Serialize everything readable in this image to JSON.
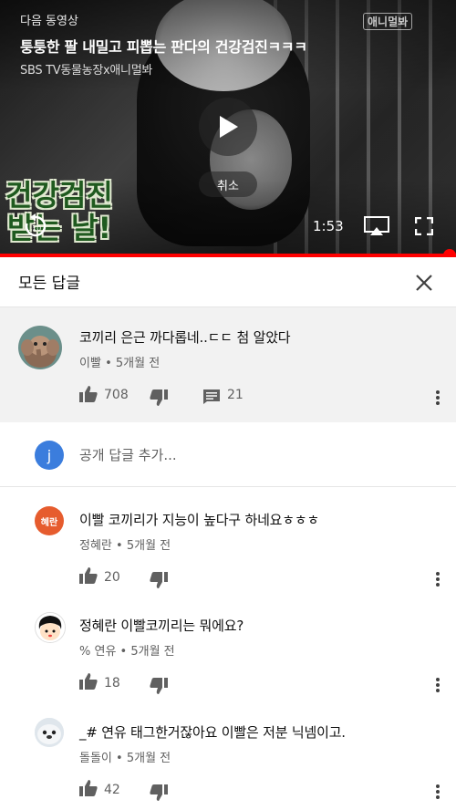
{
  "player": {
    "next_label": "다음 동영상",
    "title": "퉁퉁한 팔 내밀고 피뽑는 판다의 건강검진ㅋㅋㅋ",
    "channel": "SBS TV동물농장x애니멀봐",
    "watermark": "애니멀봐",
    "caption_line1": "건강검진",
    "caption_line2": "받는 날!",
    "cancel_label": "취소",
    "time": "1:53",
    "progress_fraction": 0.985
  },
  "panel": {
    "title": "모든 답글"
  },
  "top_comment": {
    "text": "코끼리 은근 까다롭네..ㄷㄷ 첨 알았다",
    "author": "이빨",
    "time_ago": "5개월 전",
    "likes": "708",
    "replies": "21"
  },
  "reply_input": {
    "avatar_letter": "j",
    "placeholder": "공개 답글 추가...",
    "avatar_color": "#3b7ddd"
  },
  "replies": [
    {
      "avatar_text": "혜란",
      "avatar_color": "#e65c2e",
      "text": "이빨 코끼리가 지능이 높다구 하네요ㅎㅎㅎ",
      "author": "정혜란",
      "time_ago": "5개월 전",
      "likes": "20"
    },
    {
      "text": "정혜란 이빨코끼리는 뭐에요?",
      "author": "% 연유",
      "time_ago": "5개월 전",
      "likes": "18"
    },
    {
      "text": "_# 연유 태그한거잖아요 이빨은 저분 닉넴이고.",
      "author": "돌돌이",
      "time_ago": "5개월 전",
      "likes": "42"
    }
  ],
  "separator": "•",
  "colors": {
    "progress": "#ff0000",
    "top_comment_bg": "#f2f2f2"
  }
}
